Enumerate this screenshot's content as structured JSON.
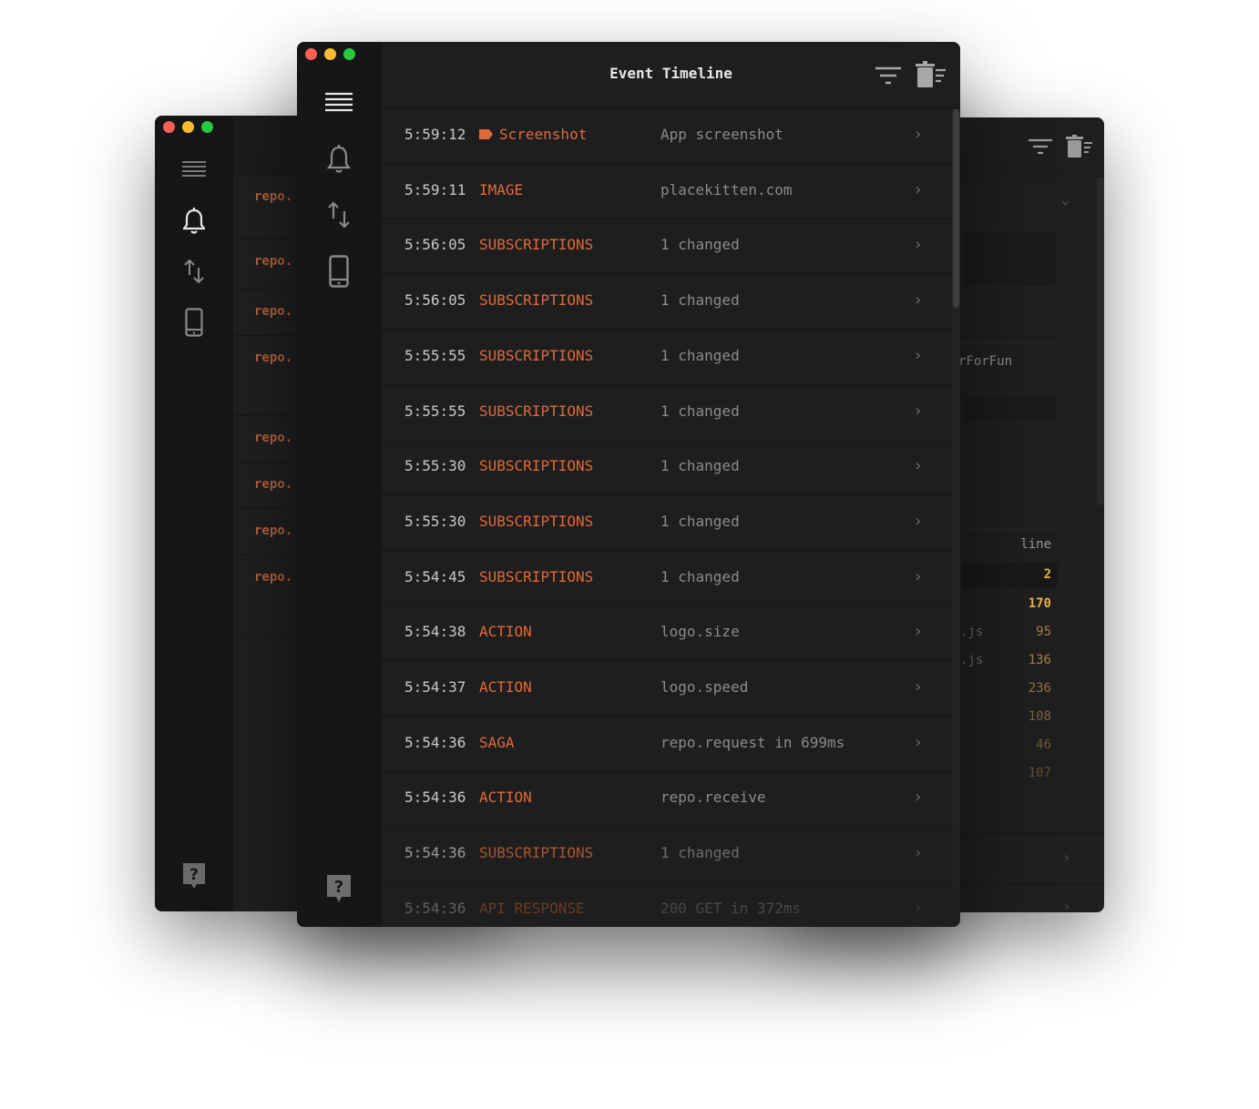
{
  "colors": {
    "accent": "#e0693a",
    "traffic_red": "#fe5f57",
    "traffic_yellow": "#febc2e",
    "traffic_green": "#28c840"
  },
  "left_window": {
    "rows": [
      "repo.",
      "repo.",
      "repo.",
      "repo.",
      "repo.",
      "repo.",
      "repo.",
      "repo."
    ]
  },
  "right_window": {
    "fragments": {
      "for_fun": "rForFun",
      "line_header": "line"
    },
    "line_numbers": [
      {
        "file": "",
        "line": "2"
      },
      {
        "file": "",
        "line": "170"
      },
      {
        "file": ".js",
        "line": "95"
      },
      {
        "file": ".js",
        "line": "136"
      },
      {
        "file": "",
        "line": "236"
      },
      {
        "file": "",
        "line": "108"
      },
      {
        "file": "",
        "line": "46"
      },
      {
        "file": "",
        "line": "107"
      }
    ]
  },
  "sidebar": {
    "icons": [
      "menu-icon",
      "bell-icon",
      "transfer-icon",
      "device-icon",
      "help-icon"
    ]
  },
  "header": {
    "title": "Event Timeline",
    "icons": [
      "filter-icon",
      "trash-icon"
    ]
  },
  "events": [
    {
      "time": "5:59:12",
      "type": "Screenshot",
      "desc": "App screenshot",
      "tagged": true
    },
    {
      "time": "5:59:11",
      "type": "IMAGE",
      "desc": "placekitten.com"
    },
    {
      "time": "5:56:05",
      "type": "SUBSCRIPTIONS",
      "desc": "1 changed"
    },
    {
      "time": "5:56:05",
      "type": "SUBSCRIPTIONS",
      "desc": "1 changed"
    },
    {
      "time": "5:55:55",
      "type": "SUBSCRIPTIONS",
      "desc": "1 changed"
    },
    {
      "time": "5:55:55",
      "type": "SUBSCRIPTIONS",
      "desc": "1 changed"
    },
    {
      "time": "5:55:30",
      "type": "SUBSCRIPTIONS",
      "desc": "1 changed"
    },
    {
      "time": "5:55:30",
      "type": "SUBSCRIPTIONS",
      "desc": "1 changed"
    },
    {
      "time": "5:54:45",
      "type": "SUBSCRIPTIONS",
      "desc": "1 changed"
    },
    {
      "time": "5:54:38",
      "type": "ACTION",
      "desc": "logo.size"
    },
    {
      "time": "5:54:37",
      "type": "ACTION",
      "desc": "logo.speed"
    },
    {
      "time": "5:54:36",
      "type": "SAGA",
      "desc": "repo.request in 699ms"
    },
    {
      "time": "5:54:36",
      "type": "ACTION",
      "desc": "repo.receive"
    },
    {
      "time": "5:54:36",
      "type": "SUBSCRIPTIONS",
      "desc": "1 changed"
    },
    {
      "time": "5:54:36",
      "type": "API RESPONSE",
      "desc": "200 GET in 372ms"
    }
  ]
}
